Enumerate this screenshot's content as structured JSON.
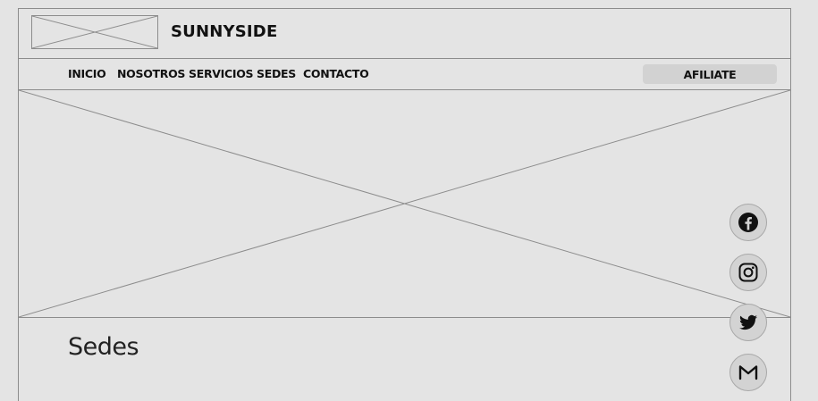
{
  "header": {
    "brand": "SUNNYSIDE"
  },
  "nav": {
    "items": [
      {
        "id": "inicio",
        "label": "INICIO"
      },
      {
        "id": "nosotros",
        "label": "NOSOTROS"
      },
      {
        "id": "servicios",
        "label": "SERVICIOS"
      },
      {
        "id": "sedes",
        "label": "SEDES"
      },
      {
        "id": "contacto",
        "label": "CONTACTO"
      }
    ],
    "cta_label": "AFILIATE"
  },
  "section": {
    "title": "Sedes"
  },
  "social": [
    {
      "name": "facebook-icon"
    },
    {
      "name": "instagram-icon"
    },
    {
      "name": "twitter-icon"
    },
    {
      "name": "gmail-icon"
    }
  ],
  "colors": {
    "background": "#e4e4e4",
    "border": "#8c8c8c",
    "button": "#d2d2d2",
    "social_button": "#d3d3d3",
    "text": "#111111"
  }
}
